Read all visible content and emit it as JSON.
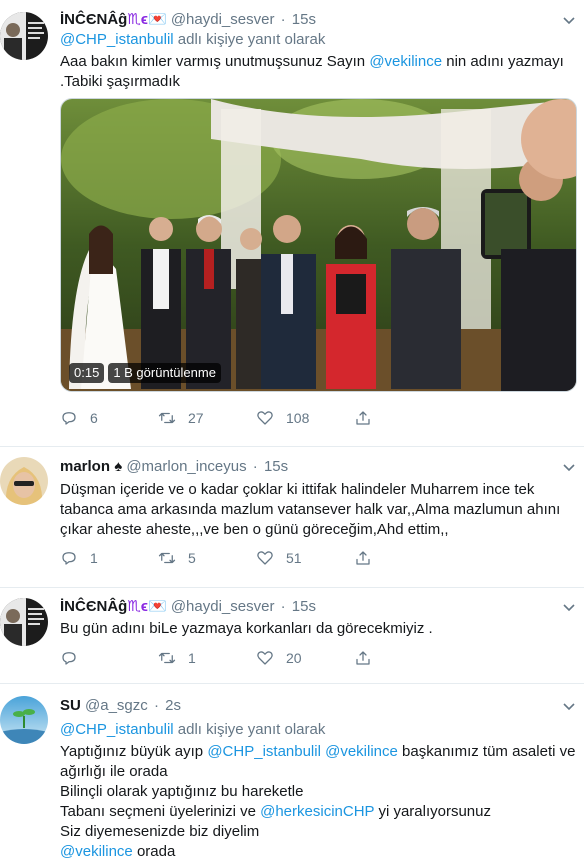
{
  "tweets": [
    {
      "name": "İΝĈЄΝÂĝ",
      "name_suffix": "♏ϵ💌",
      "handle": "@haydi_sesver",
      "time": "15s",
      "replying_to": "@CHP_istanbulil",
      "replying_suffix": "adlı kişiye yanıt olarak",
      "text_line1_a": "Aaa bakın kimler varmış unutmuşsunuz Sayın",
      "text_line1_mention": "@vekilince",
      "text_line1_b": "nin adını yazmayı",
      "text_line2": ".Tabiki şaşırmadık",
      "video_time": "0:15",
      "video_views": "1 B görüntülenme",
      "replies": "6",
      "retweets": "27",
      "likes": "108"
    },
    {
      "name": "marlon",
      "name_suffix": "♠",
      "handle": "@marlon_inceyus",
      "time": "15s",
      "text_line1": "Düşman içeride ve o kadar çoklar ki ittifak halindeler Muharrem ince tek",
      "text_line2": "tabanca ama arkasında mazlum vatansever halk var,,Alma mazlumun ahını",
      "text_line3": "çıkar aheste aheste,,,ve ben o günü göreceğim,Ahd ettim,,",
      "replies": "1",
      "retweets": "5",
      "likes": "51"
    },
    {
      "name": "İΝĈЄΝÂĝ",
      "name_suffix": "♏ϵ💌",
      "handle": "@haydi_sesver",
      "time": "15s",
      "text_line1": "Bu gün adını biLe yazmaya korkanları da görecekmiyiz .",
      "replies": "",
      "retweets": "1",
      "likes": "20"
    },
    {
      "name": "SU",
      "handle": "@a_sgzc",
      "time": "2s",
      "replying_to": "@CHP_istanbulil",
      "replying_suffix": "adlı kişiye yanıt olarak",
      "line1_a": "Yaptığınız büyük ayıp",
      "line1_m1": "@CHP_istanbulil",
      "line1_m2": "@vekilince",
      "line1_b": "başkanımız tüm asaleti ve",
      "line2": "ağırlığı ile orada",
      "line3": "Bilinçli olarak yaptığınız bu hareketle",
      "line4_a": "Tabanı seçmeni üyelerinizi ve",
      "line4_m": "@herkesicinCHP",
      "line4_b": "yi yaralıyorsunuz",
      "line5": "Siz diyemesenizde biz diyelim",
      "line6_m": "@vekilince",
      "line6_b": "orada"
    }
  ],
  "colors": {
    "link": "#1b95e0",
    "muted": "#657786",
    "border": "#e6ecf0"
  },
  "icons": [
    "reply-icon",
    "retweet-icon",
    "like-icon",
    "share-icon",
    "chevron-down-icon"
  ]
}
